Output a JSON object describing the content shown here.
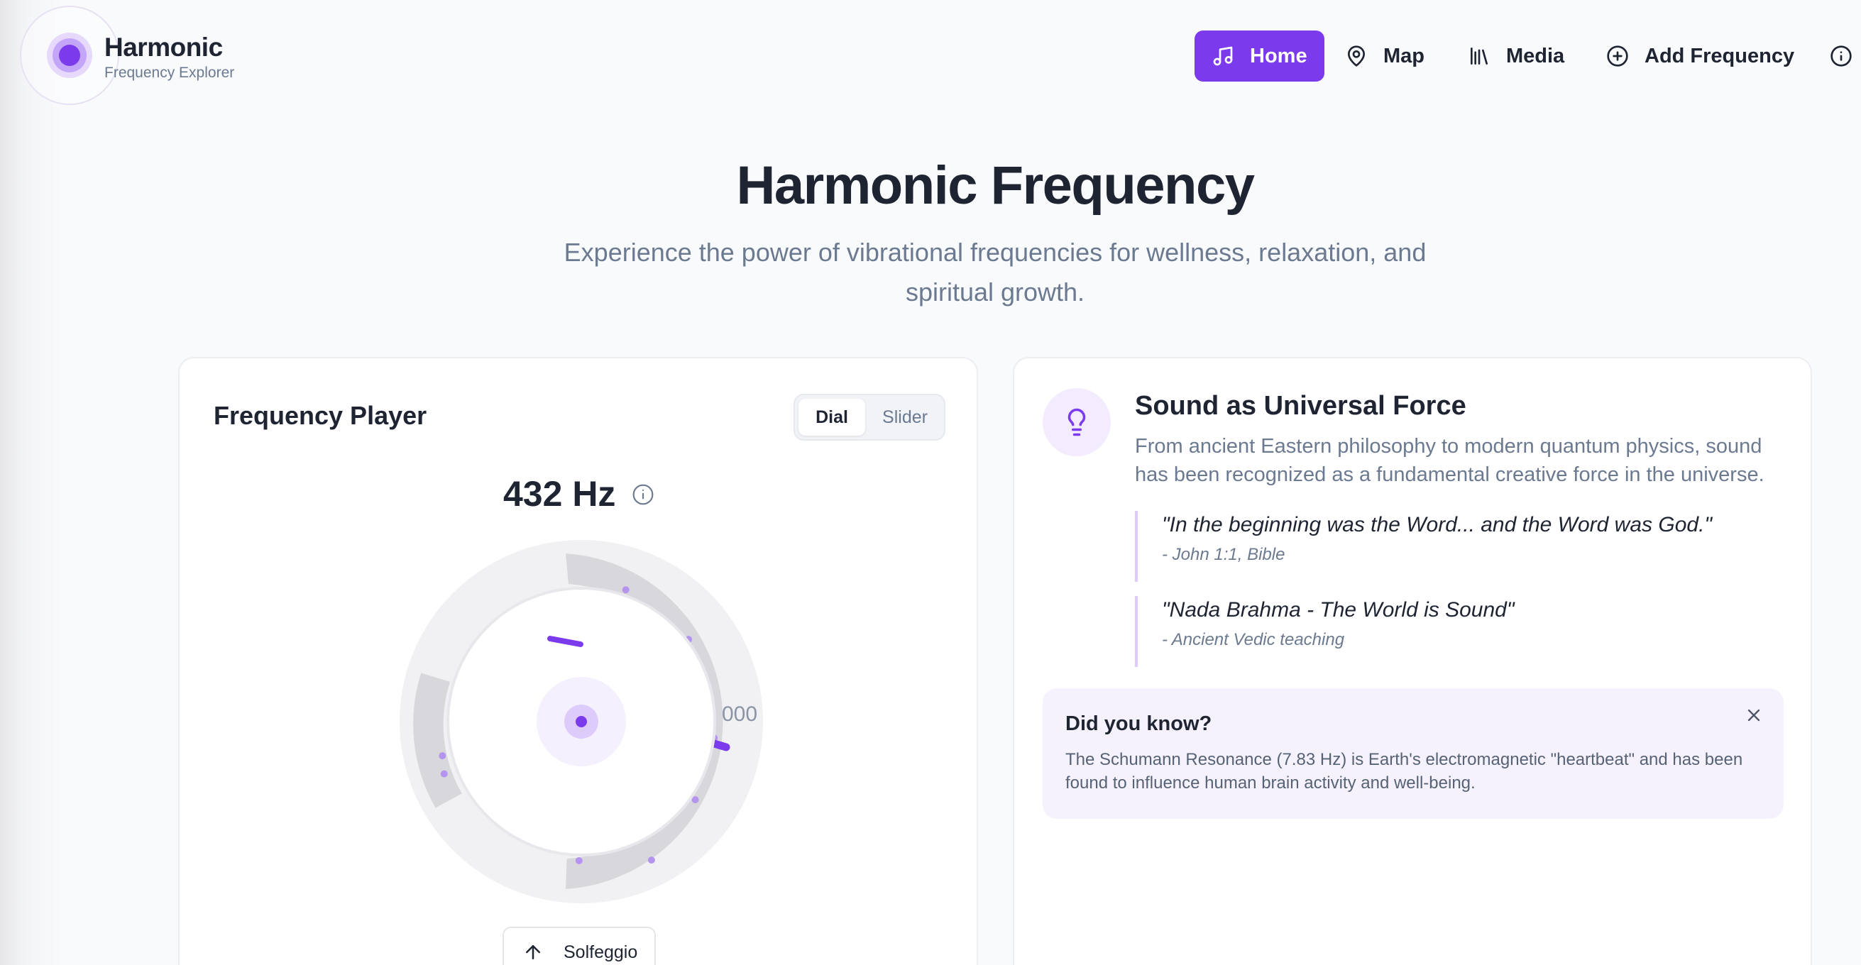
{
  "brand": {
    "name": "Harmonic",
    "subtitle": "Frequency Explorer"
  },
  "nav": {
    "items": [
      {
        "label": "Home",
        "icon": "music-note-icon",
        "active": true
      },
      {
        "label": "Map",
        "icon": "map-pin-icon",
        "active": false
      },
      {
        "label": "Media",
        "icon": "library-icon",
        "active": false
      },
      {
        "label": "Add Frequency",
        "icon": "plus-circle-icon",
        "active": false
      }
    ],
    "info_icon": "info-icon"
  },
  "hero": {
    "title": "Harmonic Frequency",
    "subtitle": "Experience the power of vibrational frequencies for wellness, relaxation, and spiritual growth."
  },
  "player": {
    "title": "Frequency Player",
    "modes": [
      "Dial",
      "Slider"
    ],
    "selected_mode": "Dial",
    "frequency": "432 Hz",
    "dial_tick_label": "000",
    "scale_button": "Solfeggio",
    "colors": {
      "accent": "#7c3aed",
      "track": "#d8d8dc"
    }
  },
  "insight": {
    "title": "Sound as Universal Force",
    "description": "From ancient Eastern philosophy to modern quantum physics, sound has been recognized as a fundamental creative force in the universe.",
    "quotes": [
      {
        "text": "\"In the beginning was the Word... and the Word was God.\"",
        "source": "- John 1:1, Bible"
      },
      {
        "text": "\"Nada Brahma - The World is Sound\"",
        "source": "- Ancient Vedic teaching"
      }
    ],
    "did_you_know": {
      "title": "Did you know?",
      "text": "The Schumann Resonance (7.83 Hz) is Earth's electromagnetic \"heartbeat\" and has been found to influence human brain activity and well-being."
    }
  }
}
